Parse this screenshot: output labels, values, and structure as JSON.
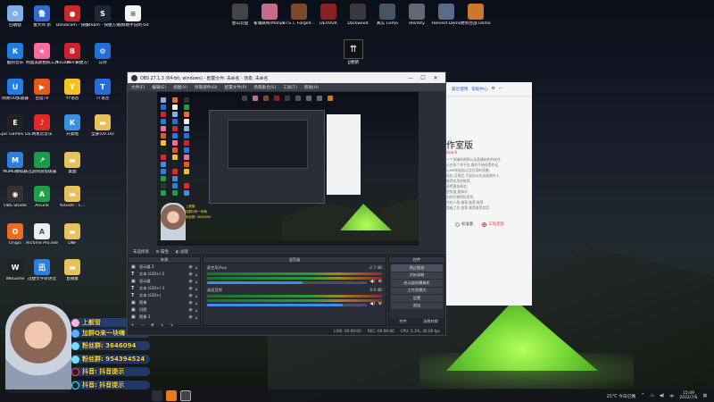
{
  "desktop_icons": [
    {
      "label": "回收站",
      "color": "#7fb0e8",
      "glyph": "♻",
      "icon": "recycle-bin-icon"
    },
    {
      "label": "鲁大师 新",
      "color": "#2f6ad8",
      "glyph": "鲁",
      "icon": "app-icon"
    },
    {
      "label": "Bandicam - 快捷方式",
      "color": "#c82a2a",
      "glyph": "●",
      "icon": "record-icon"
    },
    {
      "label": "Steam - 快捷方式",
      "color": "#1b2838",
      "glyph": "S",
      "icon": "steam-icon"
    },
    {
      "label": "视频助手说明.txt",
      "color": "#f5f5f5",
      "glyph": "≡",
      "icon": "text-file-icon"
    },
    {
      "label": "酷狗音乐",
      "color": "#1e7fe0",
      "glyph": "K",
      "icon": "app-icon"
    },
    {
      "label": "韩国美颜拍照工具",
      "color": "#ff6a9c",
      "glyph": "★",
      "icon": "app-icon"
    },
    {
      "label": "YuGiOh - 快捷方式",
      "color": "#6a2a8a",
      "glyph": "Y",
      "icon": "game-icon"
    },
    {
      "label": "BLITZ",
      "color": "#d01f2f",
      "glyph": "B",
      "icon": "game-icon"
    },
    {
      "label": "公孙",
      "color": "#226fd6",
      "glyph": "⚙",
      "icon": "app-icon"
    },
    {
      "label": "网易UU加速器",
      "color": "#1f7ee8",
      "glyph": "U",
      "icon": "app-icon"
    },
    {
      "label": "百度TV",
      "color": "#e8571b",
      "glyph": "▶",
      "icon": "app-icon"
    },
    {
      "label": "YY语音",
      "color": "#f4c320",
      "glyph": "Y",
      "icon": "app-icon"
    },
    {
      "label": "TT语音",
      "color": "#2a6bd8",
      "glyph": "T",
      "icon": "app-icon"
    },
    {
      "label": "Epic Games Launcher",
      "color": "#222",
      "glyph": "E",
      "icon": "epic-icon"
    },
    {
      "label": "网易云音乐",
      "color": "#e02a2a",
      "glyph": "♪",
      "icon": "music-icon"
    },
    {
      "label": "开黑啦",
      "color": "#3a8fe0",
      "glyph": "K",
      "icon": "app-icon"
    },
    {
      "label": "全部(v0.16)",
      "color": "#e8c15a",
      "glyph": "▬",
      "icon": "folder-icon"
    },
    {
      "label": "MuMu模拟器",
      "color": "#2a7fdf",
      "glyph": "M",
      "icon": "app-icon"
    },
    {
      "label": "迅游网游加速器",
      "color": "#1f9a4a",
      "glyph": "↗",
      "icon": "app-icon"
    },
    {
      "label": "桌面",
      "color": "#e8c15a",
      "glyph": "▬",
      "icon": "folder-icon"
    },
    {
      "label": "OBS Studio",
      "color": "#333",
      "glyph": "◉",
      "icon": "obs-icon"
    },
    {
      "label": "AnLink",
      "color": "#1ea04a",
      "glyph": "A",
      "icon": "app-icon"
    },
    {
      "label": "YuGiOh - C...",
      "color": "#e8c15a",
      "glyph": "▬",
      "icon": "folder-icon"
    },
    {
      "label": "Origin",
      "color": "#f06b1f",
      "glyph": "O",
      "icon": "origin-icon"
    },
    {
      "label": "Arctime Pro.exe",
      "color": "#eee",
      "glyph": "A",
      "icon": "app-icon"
    },
    {
      "label": "DNF",
      "color": "#e8c15a",
      "glyph": "▬",
      "icon": "folder-icon"
    },
    {
      "label": "WeGame",
      "color": "#222",
      "glyph": "W",
      "icon": "app-icon"
    },
    {
      "label": "迅捷文字转语音",
      "color": "#2a7fdf",
      "glyph": "迅",
      "icon": "app-icon"
    },
    {
      "label": "直播素",
      "color": "#e8c15a",
      "glyph": "▬",
      "icon": "folder-icon"
    }
  ],
  "top_icons": [
    {
      "label": "金山云盘",
      "color": "#444",
      "icon": "cloud-icon"
    },
    {
      "label": "雀魂麻将(Mahjong...)",
      "color": "#c86a8a",
      "icon": "game-icon"
    },
    {
      "label": "F.I.S.T. Forged ...",
      "color": "#7a4a2a",
      "icon": "game-icon"
    },
    {
      "label": "DEVOUR",
      "color": "#8a2020",
      "icon": "game-icon"
    },
    {
      "label": "Darkwood",
      "color": "#3a3a3a",
      "icon": "game-icon"
    },
    {
      "label": "真实 Cemo",
      "color": "#456",
      "icon": "game-icon"
    },
    {
      "label": "Identity",
      "color": "#667",
      "icon": "game-icon"
    },
    {
      "label": "Harvest Demo",
      "color": "#5a6a8a",
      "icon": "game-icon"
    },
    {
      "label": "野狗合战 Demo",
      "color": "#c87a2a",
      "icon": "game-icon"
    }
  ],
  "center_icon_label": "JJ更新",
  "overlay": {
    "line1": "上舰管",
    "line2": "加群Q来一块嗨",
    "line3": "粉丝群: 3646094",
    "line4": "粉丝群: 954394524",
    "line5": "抖音: 抖音提示",
    "line6": "抖音: 抖音提示"
  },
  "obs": {
    "title": "OBS 27.1.3 (64-bit, windows) - 配置文件: 未命名 - 场景: 未命名",
    "menu": [
      "文件(F)",
      "编辑(E)",
      "视图(V)",
      "停靠部件(D)",
      "配置文件(P)",
      "场景集合(S)",
      "工具(T)",
      "帮助(H)"
    ],
    "scene_bar": [
      "未选择源",
      "属性",
      "滤镜"
    ],
    "sources_header": "来源",
    "sources": [
      {
        "type": "▣",
        "name": "显示器 2"
      },
      {
        "type": "T",
        "name": "文本 (GDI+) 2"
      },
      {
        "type": "▣",
        "name": "显示器"
      },
      {
        "type": "T",
        "name": "文本 (GDI+) 3"
      },
      {
        "type": "T",
        "name": "文本 (GDI+)"
      },
      {
        "type": "▣",
        "name": "图像"
      },
      {
        "type": "▣",
        "name": "闪图"
      },
      {
        "type": "▣",
        "name": "图像 2"
      }
    ],
    "mixer_header": "混音器",
    "mixer": [
      {
        "name": "麦克风/Aux",
        "db": "-2.7 dB",
        "fader": 0.6
      },
      {
        "name": "桌面音频",
        "db": "0.0 dB",
        "fader": 0.85
      }
    ],
    "controls_header": "控件",
    "controls": [
      "停止推流",
      "开始录制",
      "启动虚拟摄像机",
      "工作室模式",
      "设置",
      "退出"
    ],
    "dock_tabs": [
      "控件",
      "场景转换"
    ],
    "status": [
      "LIVE: 00:00:00",
      "REC: 00:00:00",
      "CPU: 5.3%, 30.00 fps"
    ],
    "win_min": "—",
    "win_max": "☐",
    "win_close": "✕"
  },
  "preview_text": [
    "上舰管",
    "加群Q来一块嗨",
    "粉丝群: 3646094"
  ],
  "installer": {
    "top_links": [
      "最近使用",
      "帮助中心",
      "⚙",
      "—"
    ],
    "title": "作室版",
    "subtitle": "dwb/d",
    "lines": [
      "一个领域的视频以及直播制作的软件,",
      "已在多个多平台,操作手册很受欢迎,",
      "以MR的轻松以及好用的直播,",
      "轻松,且稳定,可轻松以在动画制作人,",
      "推荐实用并推荐,",
      "获得更多体验,",
      "更快速,整体好,",
      "为你们做到好用的,",
      "作的人群,推荐,推荐,推荐",
      "超级工作,推荐,推荐推荐实用"
    ],
    "radio_a": "标准版",
    "radio_b": "工作室版"
  },
  "taskbar": {
    "weather": "21°C 今日已晚",
    "time": "15:09",
    "date": "2022/7/6"
  }
}
